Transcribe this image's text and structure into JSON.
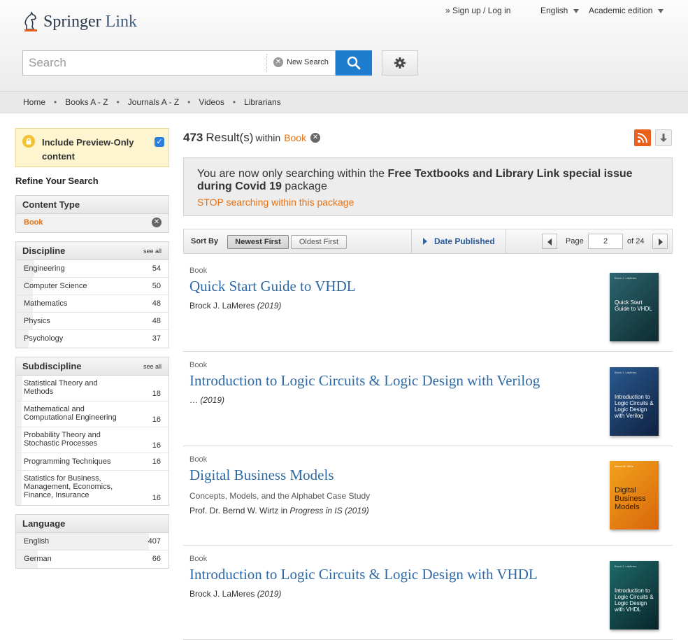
{
  "header": {
    "logo_brand": "Springer",
    "logo_suffix": "Link",
    "signup_link": "» Sign up / Log in",
    "language": "English",
    "edition": "Academic edition",
    "search_placeholder": "Search",
    "new_search_label": "New Search"
  },
  "nav": {
    "items": [
      "Home",
      "Books A - Z",
      "Journals A - Z",
      "Videos",
      "Librarians"
    ]
  },
  "sidebar": {
    "preview_label": "Include Preview-Only content",
    "preview_checked": true,
    "refine_title": "Refine Your Search",
    "content_type": {
      "title": "Content Type",
      "selected": "Book"
    },
    "discipline": {
      "title": "Discipline",
      "see_all": "see all",
      "items": [
        {
          "label": "Engineering",
          "count": "54"
        },
        {
          "label": "Computer Science",
          "count": "50"
        },
        {
          "label": "Mathematics",
          "count": "48"
        },
        {
          "label": "Physics",
          "count": "48"
        },
        {
          "label": "Psychology",
          "count": "37"
        }
      ]
    },
    "subdiscipline": {
      "title": "Subdiscipline",
      "see_all": "see all",
      "items": [
        {
          "label": "Statistical Theory and Methods",
          "count": "18"
        },
        {
          "label": "Mathematical and Computational Engineering",
          "count": "16"
        },
        {
          "label": "Probability Theory and Stochastic Processes",
          "count": "16"
        },
        {
          "label": "Programming Techniques",
          "count": "16"
        },
        {
          "label": "Statistics for Business, Management, Economics, Finance, Insurance",
          "count": "16"
        }
      ]
    },
    "language": {
      "title": "Language",
      "items": [
        {
          "label": "English",
          "count": "407"
        },
        {
          "label": "German",
          "count": "66"
        }
      ]
    }
  },
  "results": {
    "count": "473",
    "label": "Result(s)",
    "within": "within",
    "filter": "Book",
    "package_prefix": "You are now only searching within the ",
    "package_name": "Free Textbooks and Library Link special issue during Covid 19",
    "package_suffix": " package",
    "stop_link": "STOP searching within this package"
  },
  "sortbar": {
    "sort_by": "Sort By",
    "newest": "Newest First",
    "oldest": "Oldest First",
    "date_published": "Date Published",
    "page_label": "Page",
    "page_value": "2",
    "page_of": "of 24"
  },
  "items": [
    {
      "type": "Book",
      "title": "Quick Start Guide to VHDL",
      "author": "Brock J. LaMeres",
      "year": "(2019)",
      "cover_text": "Quick Start Guide to VHDL",
      "cover_color": "#1f4a52"
    },
    {
      "type": "Book",
      "title": "Introduction to Logic Circuits & Logic Design with Verilog",
      "author": "…",
      "year": "(2019)",
      "cover_text": "Introduction to Logic Circuits & Logic Design with Verilog",
      "cover_color": "#17385f"
    },
    {
      "type": "Book",
      "title": "Digital Business Models",
      "subtitle": "Concepts, Models, and the Alphabet Case Study",
      "author": "Prof. Dr. Bernd W. Wirtz",
      "series": "Progress in IS",
      "year": "(2019)",
      "cover_text": "Digital Business Models",
      "cover_color": "#e88a12"
    },
    {
      "type": "Book",
      "title": "Introduction to Logic Circuits & Logic Design with VHDL",
      "author": "Brock J. LaMeres",
      "year": "(2019)",
      "cover_text": "Introduction to Logic Circuits & Logic Design with VHDL",
      "cover_color": "#103a42"
    }
  ],
  "colors": {
    "accent_orange": "#e8700e",
    "link_blue": "#2f6aa5",
    "search_button": "#1f7dd0"
  }
}
